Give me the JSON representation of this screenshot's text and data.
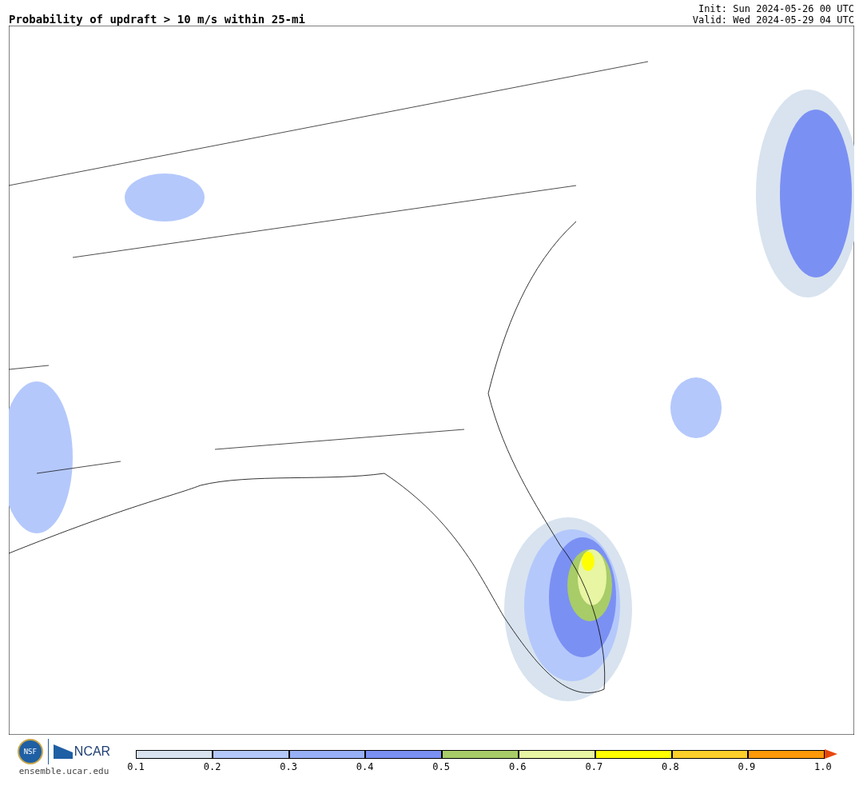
{
  "title": "Probability of updraft > 10 m/s within 25-mi",
  "init": "Init: Sun 2024-05-26 00 UTC",
  "valid": "Valid: Wed 2024-05-29 04 UTC",
  "logos": {
    "nsf": "NSF",
    "ncar": "NCAR",
    "url": "ensemble.ucar.edu"
  },
  "colorbar": {
    "bins": [
      {
        "color": "#d8e3ef"
      },
      {
        "color": "#b4c8fb"
      },
      {
        "color": "#98b0f6"
      },
      {
        "color": "#7b90f3"
      },
      {
        "color": "#a8cc68"
      },
      {
        "color": "#e8f5a3"
      },
      {
        "color": "#ffff00"
      },
      {
        "color": "#fdcf2a"
      },
      {
        "color": "#fe9a0a"
      }
    ],
    "extend": {
      "color": "#e8470c"
    },
    "ticks": [
      "0.1",
      "0.2",
      "0.3",
      "0.4",
      "0.5",
      "0.6",
      "0.7",
      "0.8",
      "0.9",
      "1.0"
    ]
  }
}
